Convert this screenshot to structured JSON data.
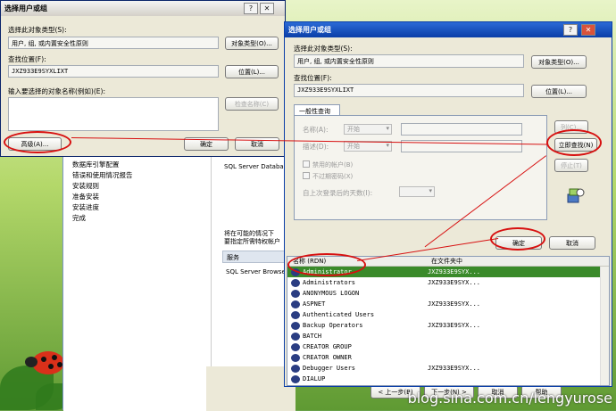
{
  "win1": {
    "title": "选择用户或组",
    "help": "?",
    "close": "✕",
    "obj_type_label": "选择此对象类型(S):",
    "obj_type_value": "用户, 组, 或内置安全性原则",
    "obj_type_btn": "对象类型(O)...",
    "location_label": "查找位置(F):",
    "location_value": "JXZ933E9SYXLIXT",
    "location_btn": "位置(L)...",
    "enter_label": "输入要选择的对象名称(例如)(E):",
    "check_btn": "检查名称(C)",
    "advanced_btn": "高级(A)...",
    "ok_btn": "确定",
    "cancel_btn": "取消"
  },
  "installer": {
    "steps": [
      "数据库引擎配置",
      "错误和使用情况报告",
      "安装规则",
      "准备安装",
      "安装进度",
      "完成"
    ],
    "service_text": "SQL Server Databas",
    "info_text_1": "将在可能的情况下",
    "info_text_2": "要指定所需特权帐户",
    "col_service": "服务",
    "row_service": "SQL Server Browser",
    "back_btn": "< 上一步(B)",
    "next_btn": "下一步(N) >",
    "cancel_btn": "取消",
    "help_btn": "帮助"
  },
  "win2": {
    "title": "选择用户或组",
    "help": "?",
    "close": "✕",
    "obj_type_label": "选择此对象类型(S):",
    "obj_type_value": "用户, 组, 或内置安全性原则",
    "obj_type_btn": "对象类型(O)...",
    "location_label": "查找位置(F):",
    "location_value": "JXZ933E9SYXLIXT",
    "location_btn": "位置(L)...",
    "tab_label": "一般性查询",
    "name_label": "名称(A):",
    "desc_label": "描述(D):",
    "starts_with": "开始",
    "disabled_accounts": "禁用的帐户(B)",
    "nonexpiring_pw": "不过期密码(X)",
    "days_label": "自上次登录后的天数(I):",
    "columns_btn": "列(C)...",
    "find_now_btn": "立即查找(N)",
    "stop_btn": "停止(T)",
    "ok_btn": "确定",
    "cancel_btn": "取消",
    "results_col_name": "名称 (RDN)",
    "results_col_folder": "在文件夹中",
    "results": [
      {
        "name": "Administrator",
        "folder": "JXZ933E9SYX...",
        "selected": true
      },
      {
        "name": "Administrators",
        "folder": "JXZ933E9SYX..."
      },
      {
        "name": "ANONYMOUS LOGON",
        "folder": ""
      },
      {
        "name": "ASPNET",
        "folder": "JXZ933E9SYX..."
      },
      {
        "name": "Authenticated Users",
        "folder": ""
      },
      {
        "name": "Backup Operators",
        "folder": "JXZ933E9SYX..."
      },
      {
        "name": "BATCH",
        "folder": ""
      },
      {
        "name": "CREATOR GROUP",
        "folder": ""
      },
      {
        "name": "CREATOR OWNER",
        "folder": ""
      },
      {
        "name": "Debugger Users",
        "folder": "JXZ933E9SYX..."
      },
      {
        "name": "DIALUP",
        "folder": ""
      }
    ]
  },
  "watermark": "blog.sina.com.cn/lengyurose",
  "colors": {
    "annotation": "#d71010",
    "title_active": "#0a3ea8",
    "dialog_bg": "#ece9d8",
    "selection": "#3a8a2a"
  }
}
